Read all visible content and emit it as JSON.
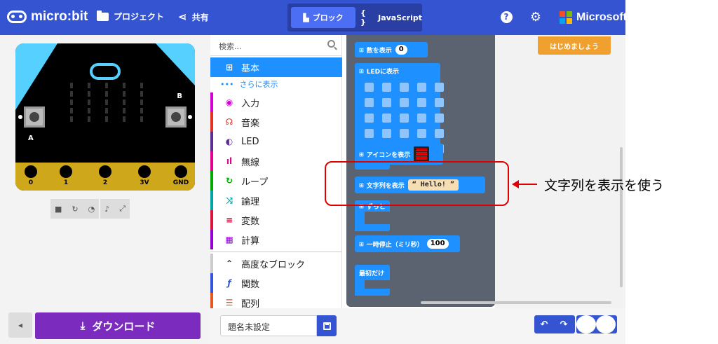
{
  "header": {
    "brand": "micro:bit",
    "projects_label": "プロジェクト",
    "share_label": "共有",
    "mode_blocks_label": "ブロック",
    "mode_js_label": "JavaScript",
    "mode_js_icon_text": "{ }",
    "microsoft_label": "Microsoft",
    "microsoft_colors": [
      "#F25022",
      "#7FBA00",
      "#00A4EF",
      "#FFB900"
    ]
  },
  "simulator": {
    "button_a_label": "A",
    "button_b_label": "B",
    "pins": [
      "0",
      "1",
      "2",
      "3V",
      "GND"
    ],
    "toolbar_icons": [
      "stop-icon",
      "restart-icon",
      "slow-motion-icon",
      "sound-icon",
      "fullscreen-icon"
    ]
  },
  "toolbox": {
    "search_placeholder": "検索...",
    "more_label": "さらに表示",
    "categories": [
      {
        "label": "基本",
        "icon": "⊞",
        "color": "#1E90FF"
      },
      {
        "label": "入力",
        "icon": "◉",
        "color": "#D400D4"
      },
      {
        "label": "音楽",
        "icon": "☊",
        "color": "#E63022"
      },
      {
        "label": "LED",
        "icon": "◐",
        "color": "#5C2D91"
      },
      {
        "label": "無線",
        "icon": "ıl",
        "color": "#E3008C"
      },
      {
        "label": "ループ",
        "icon": "↻",
        "color": "#00AA00"
      },
      {
        "label": "論理",
        "icon": "⤨",
        "color": "#00A4A6"
      },
      {
        "label": "変数",
        "icon": "≡",
        "color": "#DC143C"
      },
      {
        "label": "計算",
        "icon": "▦",
        "color": "#9400D3"
      }
    ],
    "advanced_label": "高度なブロック",
    "advanced_categories": [
      {
        "label": "関数",
        "icon": "ƒ",
        "color": "#3455DB"
      },
      {
        "label": "配列",
        "icon": "☰",
        "color": "#E65722"
      }
    ]
  },
  "flyout": {
    "show_number": {
      "label": "数を表示",
      "value": "0"
    },
    "show_leds": {
      "label": "LEDに表示"
    },
    "show_icon": {
      "label": "アイコンを表示"
    },
    "show_string": {
      "label": "文字列を表示",
      "value": "Hello!",
      "open_quote": "“",
      "close_quote": "”"
    },
    "forever": {
      "label": "ずっと"
    },
    "pause": {
      "label": "一時停止（ミリ秒）",
      "value": "100"
    },
    "on_start": {
      "label": "最初だけ"
    }
  },
  "workspace": {
    "tutorial_button": "はじめましょう"
  },
  "bottom": {
    "download_label": "ダウンロード",
    "project_name": "題名未設定"
  },
  "annotation": {
    "callout_text": "文字列を表示を使う"
  }
}
